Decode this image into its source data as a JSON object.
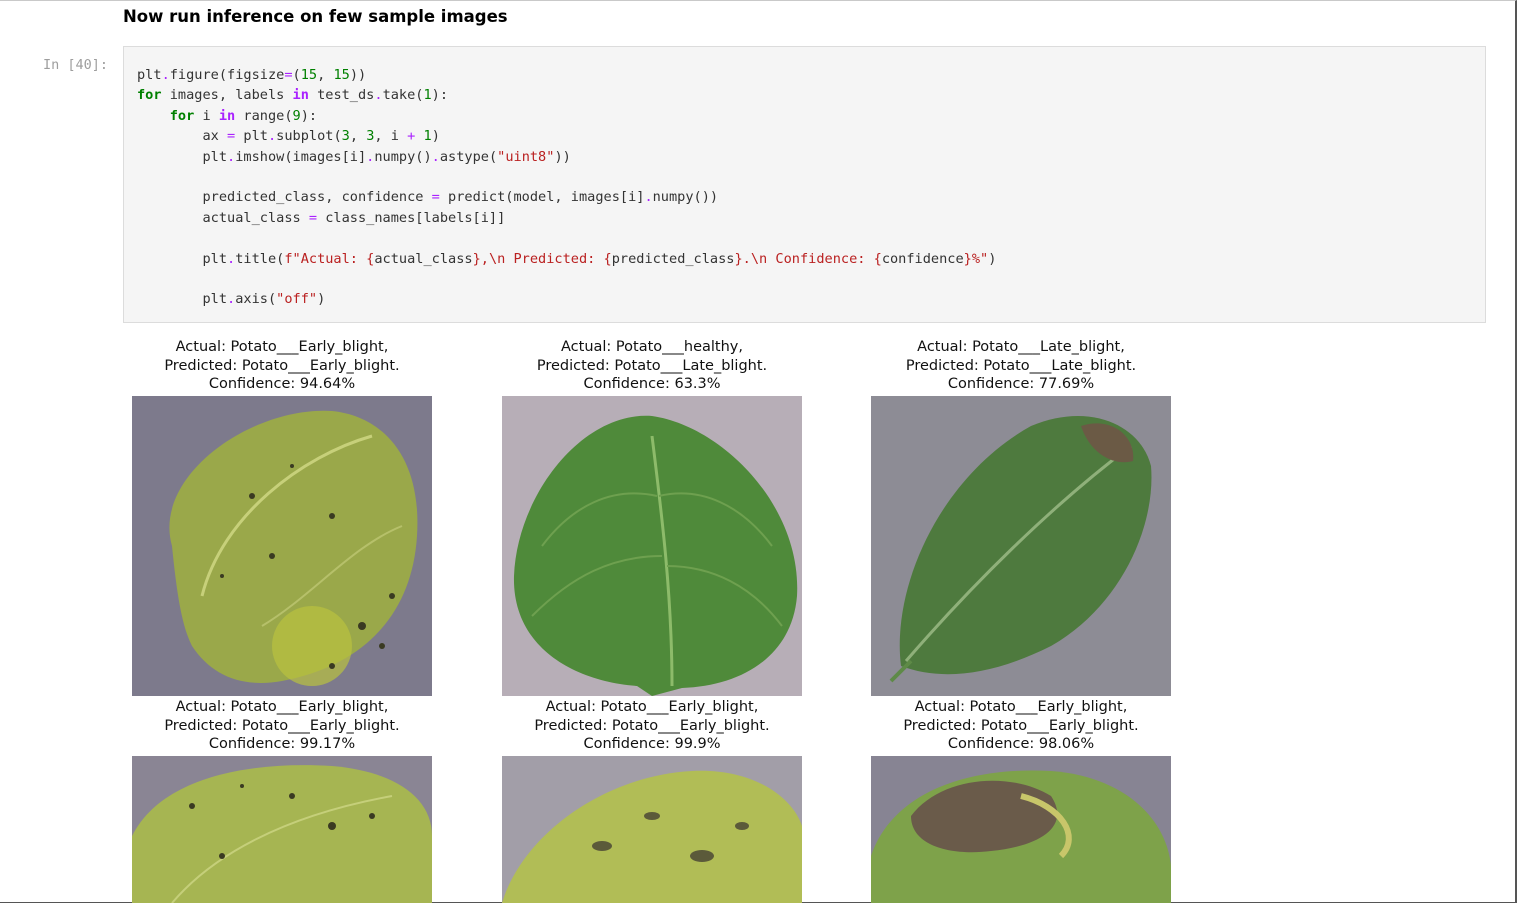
{
  "markdown": {
    "heading": "Now run inference on few sample images"
  },
  "cell": {
    "prompt": "In [40]:"
  },
  "results": [
    {
      "actual": "Actual: Potato___Early_blight,",
      "predicted": "Predicted: Potato___Early_blight.",
      "confidence": "Confidence: 94.64%",
      "image_icon": "leaf-early-blight-image"
    },
    {
      "actual": "Actual: Potato___healthy,",
      "predicted": "Predicted: Potato___Late_blight.",
      "confidence": "Confidence: 63.3%",
      "image_icon": "leaf-healthy-image"
    },
    {
      "actual": "Actual: Potato___Late_blight,",
      "predicted": "Predicted: Potato___Late_blight.",
      "confidence": "Confidence: 77.69%",
      "image_icon": "leaf-late-blight-image"
    },
    {
      "actual": "Actual: Potato___Early_blight,",
      "predicted": "Predicted: Potato___Early_blight.",
      "confidence": "Confidence: 99.17%",
      "image_icon": "leaf-early-blight-image"
    },
    {
      "actual": "Actual: Potato___Early_blight,",
      "predicted": "Predicted: Potato___Early_blight.",
      "confidence": "Confidence: 99.9%",
      "image_icon": "leaf-early-blight-image"
    },
    {
      "actual": "Actual: Potato___Early_blight,",
      "predicted": "Predicted: Potato___Early_blight.",
      "confidence": "Confidence: 98.06%",
      "image_icon": "leaf-early-blight-image"
    }
  ],
  "colors": {
    "code_bg": "#f5f5f5",
    "keyword": "#008000",
    "string": "#ba2121",
    "operator": "#aa22ff",
    "prompt": "#9e9e9e"
  }
}
